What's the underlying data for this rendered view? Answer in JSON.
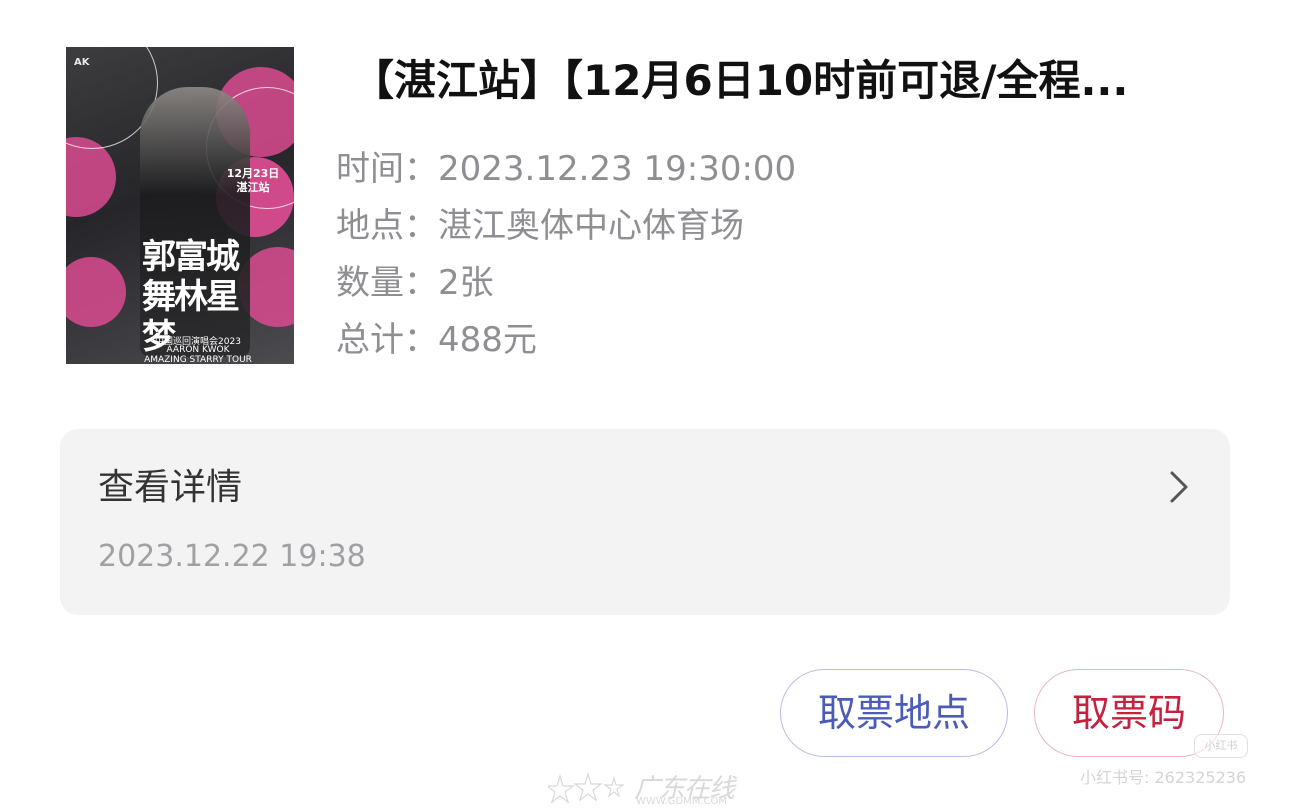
{
  "order": {
    "title": "【湛江站】【12月6日10时前可退/全程...",
    "poster": {
      "date_line": "12月23日",
      "station_line": "湛江站",
      "big_title": "郭富城舞林星梦",
      "tour_line1": "中国巡回演唱会2023",
      "tour_line2": "AARON KWOK",
      "tour_line3": "AMAZING STARRY TOUR",
      "colors": {
        "accent_pink": "#d94b8f",
        "background": "#2e2e32"
      }
    },
    "info": [
      {
        "label": "时间：",
        "value": "2023.12.23 19:30:00"
      },
      {
        "label": "地点：",
        "value": "湛江奥体中心体育场"
      },
      {
        "label": "数量：",
        "value": "2张"
      },
      {
        "label": "总计：",
        "value": "488元"
      }
    ]
  },
  "details": {
    "title": "查看详情",
    "time": "2023.12.22 19:38",
    "icon": "chevron-right-icon"
  },
  "buttons": {
    "location_label": "取票地点",
    "code_label": "取票码",
    "colors": {
      "location": "#4a5bb8",
      "code": "#c4223f"
    }
  },
  "watermarks": {
    "brand": "广东在线",
    "url": "WWW.GDMM.COM",
    "platform_id": "小红书号: 262325236",
    "platform_badge": "小红书"
  }
}
